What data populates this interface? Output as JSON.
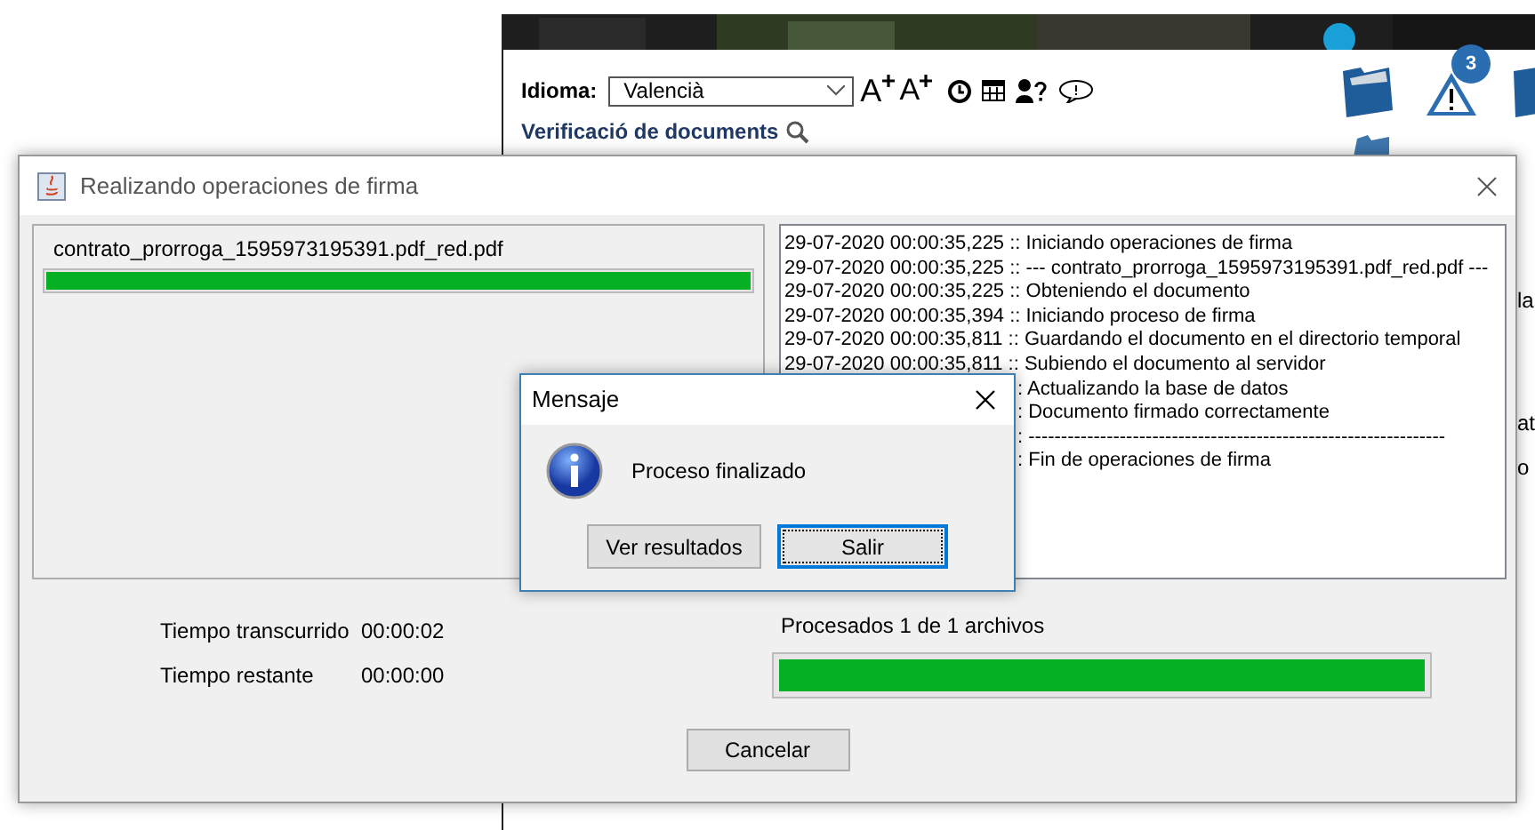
{
  "web_page": {
    "language_label": "Idioma:",
    "language_value": "Valencià",
    "text_size_buttons": [
      "A",
      "A"
    ],
    "link": "Verificació de documents",
    "alerts_badge": "3",
    "edge_fragments": [
      "la",
      "at",
      "o"
    ]
  },
  "progress_window": {
    "title": "Realizando operaciones de firma",
    "files": [
      {
        "name": "contrato_prorroga_1595973195391.pdf_red.pdf",
        "level": 1
      }
    ],
    "log": [
      {
        "kind": "full",
        "text": "29-07-2020 00:00:35,225 :: Iniciando operaciones de firma"
      },
      {
        "kind": "full",
        "text": "29-07-2020 00:00:35,225 :: --- contrato_prorroga_1595973195391.pdf_red.pdf ---"
      },
      {
        "kind": "full",
        "text": "29-07-2020 00:00:35,225 :: Obteniendo el documento"
      },
      {
        "kind": "full",
        "text": "29-07-2020 00:00:35,394 :: Iniciando proceso de firma"
      },
      {
        "kind": "full",
        "text": "29-07-2020 00:00:35,811 :: Guardando el documento en el directorio temporal"
      },
      {
        "kind": "full",
        "text": "29-07-2020 00:00:35,811 :: Subiendo el documento al servidor"
      },
      {
        "kind": "tail",
        "text": ": Actualizando la base de datos"
      },
      {
        "kind": "tail",
        "text": ": Documento firmado correctamente"
      },
      {
        "kind": "tail",
        "text": ": ----------------------------------------------------------------"
      },
      {
        "kind": "tail",
        "text": ": Fin de operaciones de firma"
      }
    ],
    "elapsed_label": "Tiempo transcurrido",
    "elapsed_value": "00:00:02",
    "remaining_label": "Tiempo restante",
    "remaining_value": "00:00:00",
    "processed": "Procesados 1 de 1 archivos",
    "total_progress": {
      "level": 1
    },
    "cancel_button": "Cancelar"
  },
  "message_dialog": {
    "title": "Mensaje",
    "message": "Proceso finalizado",
    "buttons": [
      {
        "label": "Ver resultados",
        "focused": false
      },
      {
        "label": "Salir",
        "focused": true
      }
    ]
  }
}
